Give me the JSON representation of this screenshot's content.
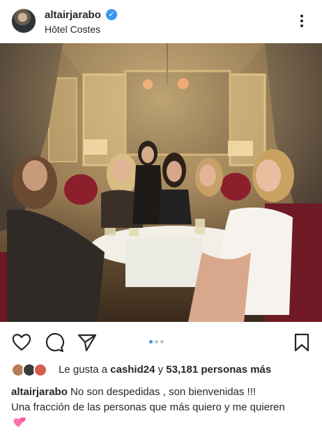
{
  "post": {
    "username": "altairjarabo",
    "location": "Hôtel Costes",
    "verified": true
  },
  "actions": {
    "carousel_count": 3,
    "carousel_active_index": 0
  },
  "likes": {
    "prefix": "Le gusta a",
    "first_liker": "cashid24",
    "connector": "y",
    "others": "53,181 personas más"
  },
  "caption": {
    "username": "altairjarabo",
    "line1": "No son despedidas , son bienvenidas !!!",
    "line2": "Una fracción de las personas que más quiero y me quieren",
    "emoji": "two-hearts"
  },
  "colors": {
    "accent": "#3897f0",
    "text": "#262626",
    "heart": "#ff6fae"
  },
  "icons": [
    "more-options-icon",
    "heart-icon",
    "comment-icon",
    "share-icon",
    "save-icon",
    "verified-badge-icon"
  ]
}
